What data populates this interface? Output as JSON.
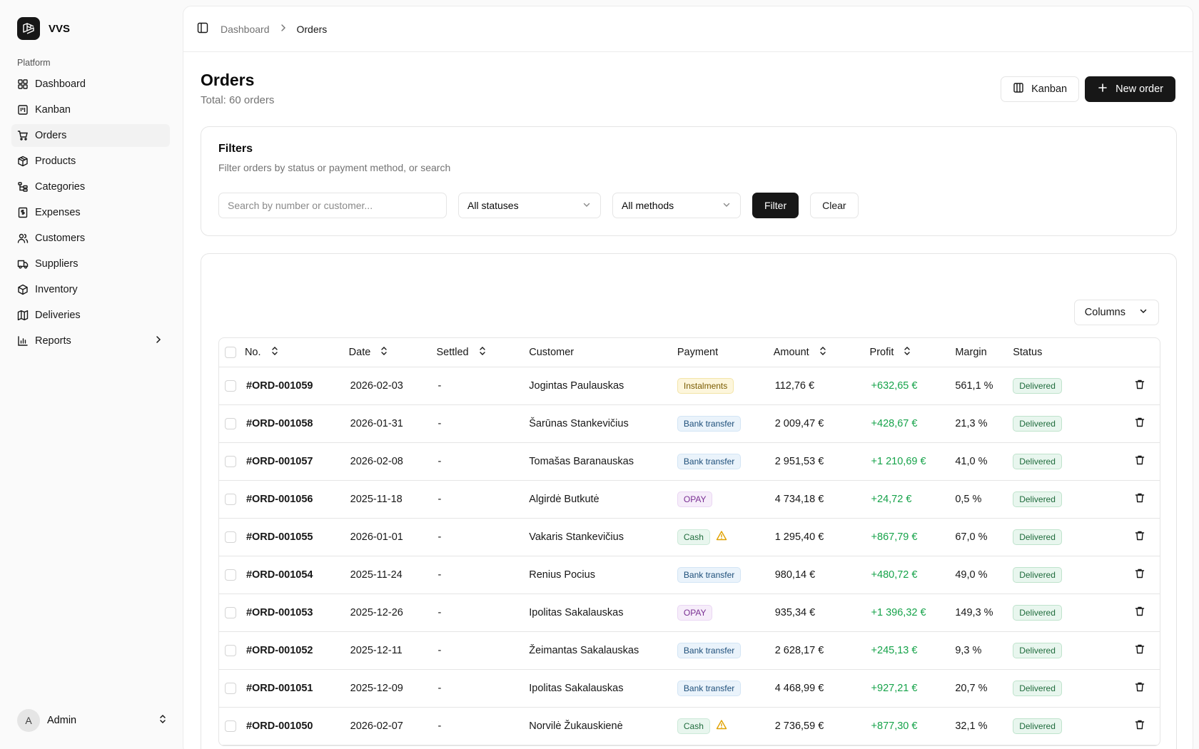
{
  "app": {
    "name": "VVS"
  },
  "sidebar": {
    "section": "Platform",
    "items": [
      {
        "label": "Dashboard",
        "icon": "dashboard-icon"
      },
      {
        "label": "Kanban",
        "icon": "kanban-icon"
      },
      {
        "label": "Orders",
        "icon": "cart-icon",
        "active": true
      },
      {
        "label": "Products",
        "icon": "package-icon"
      },
      {
        "label": "Categories",
        "icon": "categories-icon"
      },
      {
        "label": "Expenses",
        "icon": "receipt-icon"
      },
      {
        "label": "Customers",
        "icon": "users-icon"
      },
      {
        "label": "Suppliers",
        "icon": "truck-icon"
      },
      {
        "label": "Inventory",
        "icon": "box-icon"
      },
      {
        "label": "Deliveries",
        "icon": "map-icon"
      },
      {
        "label": "Reports",
        "icon": "chart-icon"
      }
    ],
    "user": {
      "initial": "A",
      "name": "Admin"
    }
  },
  "breadcrumb": {
    "parent": "Dashboard",
    "current": "Orders"
  },
  "header": {
    "title": "Orders",
    "subtitle": "Total: 60 orders",
    "kanban_label": "Kanban",
    "new_order_label": "New order"
  },
  "filters": {
    "title": "Filters",
    "description": "Filter orders by status or payment method, or search",
    "search_placeholder": "Search by number or customer...",
    "status_value": "All statuses",
    "method_value": "All methods",
    "filter_label": "Filter",
    "clear_label": "Clear"
  },
  "table": {
    "columns_label": "Columns",
    "headers": {
      "no": "No.",
      "date": "Date",
      "settled": "Settled",
      "customer": "Customer",
      "payment": "Payment",
      "amount": "Amount",
      "profit": "Profit",
      "margin": "Margin",
      "status": "Status"
    },
    "rows": [
      {
        "no": "#ORD-001059",
        "date": "2026-02-03",
        "settled": "-",
        "customer": "Jogintas Paulauskas",
        "payment": "Instalments",
        "payment_type": "inst",
        "warn": false,
        "amount": "112,76 €",
        "profit": "+632,65 €",
        "margin": "561,1 %",
        "status": "Delivered"
      },
      {
        "no": "#ORD-001058",
        "date": "2026-01-31",
        "settled": "-",
        "customer": "Šarūnas Stankevičius",
        "payment": "Bank transfer",
        "payment_type": "bank",
        "warn": false,
        "amount": "2 009,47 €",
        "profit": "+428,67 €",
        "margin": "21,3 %",
        "status": "Delivered"
      },
      {
        "no": "#ORD-001057",
        "date": "2026-02-08",
        "settled": "-",
        "customer": "Tomašas Baranauskas",
        "payment": "Bank transfer",
        "payment_type": "bank",
        "warn": false,
        "amount": "2 951,53 €",
        "profit": "+1 210,69 €",
        "margin": "41,0 %",
        "status": "Delivered"
      },
      {
        "no": "#ORD-001056",
        "date": "2025-11-18",
        "settled": "-",
        "customer": "Algirdė Butkutė",
        "payment": "OPAY",
        "payment_type": "opay",
        "warn": false,
        "amount": "4 734,18 €",
        "profit": "+24,72 €",
        "margin": "0,5 %",
        "status": "Delivered"
      },
      {
        "no": "#ORD-001055",
        "date": "2026-01-01",
        "settled": "-",
        "customer": "Vakaris Stankevičius",
        "payment": "Cash",
        "payment_type": "cash",
        "warn": true,
        "amount": "1 295,40 €",
        "profit": "+867,79 €",
        "margin": "67,0 %",
        "status": "Delivered"
      },
      {
        "no": "#ORD-001054",
        "date": "2025-11-24",
        "settled": "-",
        "customer": "Renius Pocius",
        "payment": "Bank transfer",
        "payment_type": "bank",
        "warn": false,
        "amount": "980,14 €",
        "profit": "+480,72 €",
        "margin": "49,0 %",
        "status": "Delivered"
      },
      {
        "no": "#ORD-001053",
        "date": "2025-12-26",
        "settled": "-",
        "customer": "Ipolitas Sakalauskas",
        "payment": "OPAY",
        "payment_type": "opay",
        "warn": false,
        "amount": "935,34 €",
        "profit": "+1 396,32 €",
        "margin": "149,3 %",
        "status": "Delivered"
      },
      {
        "no": "#ORD-001052",
        "date": "2025-12-11",
        "settled": "-",
        "customer": "Žeimantas Sakalauskas",
        "payment": "Bank transfer",
        "payment_type": "bank",
        "warn": false,
        "amount": "2 628,17 €",
        "profit": "+245,13 €",
        "margin": "9,3 %",
        "status": "Delivered"
      },
      {
        "no": "#ORD-001051",
        "date": "2025-12-09",
        "settled": "-",
        "customer": "Ipolitas Sakalauskas",
        "payment": "Bank transfer",
        "payment_type": "bank",
        "warn": false,
        "amount": "4 468,99 €",
        "profit": "+927,21 €",
        "margin": "20,7 %",
        "status": "Delivered"
      },
      {
        "no": "#ORD-001050",
        "date": "2026-02-07",
        "settled": "-",
        "customer": "Norvilė Žukauskienė",
        "payment": "Cash",
        "payment_type": "cash",
        "warn": true,
        "amount": "2 736,59 €",
        "profit": "+877,30 €",
        "margin": "32,1 %",
        "status": "Delivered"
      }
    ]
  }
}
